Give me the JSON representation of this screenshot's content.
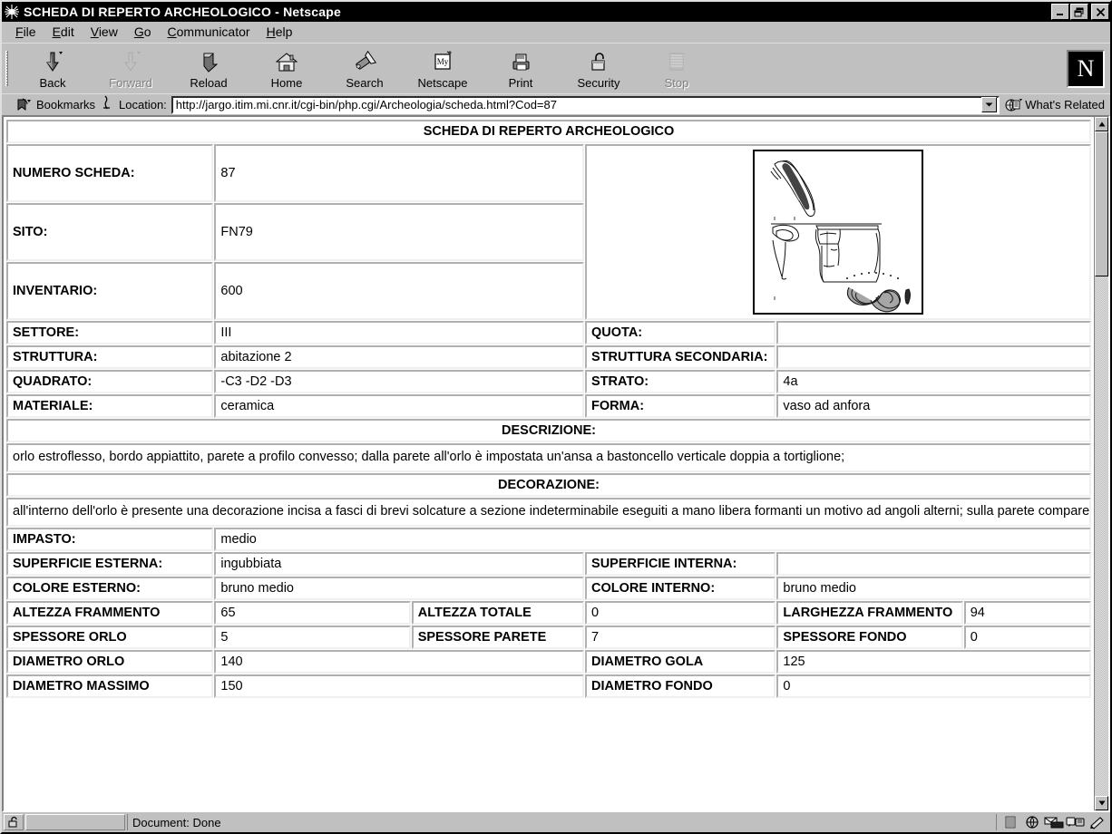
{
  "window": {
    "title": "SCHEDA DI REPERTO ARCHEOLOGICO - Netscape",
    "app_icon": "netscape-window-icon",
    "minimize_label": "_",
    "restore_label": "❐",
    "close_label": "✕"
  },
  "menu": [
    {
      "label": "File",
      "accel": "F"
    },
    {
      "label": "Edit",
      "accel": "E"
    },
    {
      "label": "View",
      "accel": "V"
    },
    {
      "label": "Go",
      "accel": "G"
    },
    {
      "label": "Communicator",
      "accel": "C"
    },
    {
      "label": "Help",
      "accel": "H"
    }
  ],
  "toolbar": {
    "buttons": [
      {
        "label": "Back",
        "icon": "back-arrow-icon",
        "enabled": true
      },
      {
        "label": "Forward",
        "icon": "forward-arrow-icon",
        "enabled": false
      },
      {
        "label": "Reload",
        "icon": "reload-icon",
        "enabled": true
      },
      {
        "label": "Home",
        "icon": "home-icon",
        "enabled": true
      },
      {
        "label": "Search",
        "icon": "search-flashlight-icon",
        "enabled": true
      },
      {
        "label": "Netscape",
        "icon": "my-netscape-icon",
        "enabled": true
      },
      {
        "label": "Print",
        "icon": "printer-icon",
        "enabled": true
      },
      {
        "label": "Security",
        "icon": "padlock-icon",
        "enabled": true
      },
      {
        "label": "Stop",
        "icon": "stop-icon",
        "enabled": false
      }
    ],
    "logo_letter": "N",
    "logo_name": "netscape-logo"
  },
  "location_bar": {
    "bookmarks_label": "Bookmarks",
    "bookmarks_icon": "bookmark-icon",
    "page_proxy_icon": "page-proxy-icon",
    "location_label": "Location:",
    "url": "http://jargo.itim.mi.cnr.it/cgi-bin/php.cgi/Archeologia/scheda.html?Cod=87",
    "url_placeholder": "Location:",
    "dropdown_icon": "chevron-down-icon",
    "whats_related_label": "What's Related",
    "whats_related_icon": "whats-related-icon"
  },
  "page": {
    "heading": "SCHEDA DI REPERTO ARCHEOLOGICO",
    "drawing_alt": "archaeological-pottery-drawing",
    "top_fields": [
      {
        "label": "NUMERO SCHEDA:",
        "value": "87"
      },
      {
        "label": "SITO:",
        "value": "FN79"
      },
      {
        "label": "INVENTARIO:",
        "value": "600"
      }
    ],
    "paired_fields": [
      {
        "left_label": "SETTORE:",
        "left_value": "III",
        "right_label": "QUOTA:",
        "right_value": ""
      },
      {
        "left_label": "STRUTTURA:",
        "left_value": "abitazione 2",
        "right_label": "STRUTTURA SECONDARIA:",
        "right_value": ""
      },
      {
        "left_label": "QUADRATO:",
        "left_value": "-C3 -D2 -D3",
        "right_label": "STRATO:",
        "right_value": "4a"
      },
      {
        "left_label": "MATERIALE:",
        "left_value": "ceramica",
        "right_label": "FORMA:",
        "right_value": "vaso ad anfora"
      }
    ],
    "descrizione": {
      "heading": "DESCRIZIONE:",
      "text": "orlo estroflesso, bordo appiattito, parete a profilo convesso; dalla parete all'orlo è impostata un'ansa a bastoncello verticale doppia a tortiglione;"
    },
    "decorazione": {
      "heading": "DECORAZIONE:",
      "text": "all'interno dell'orlo è presente una decorazione incisa a fasci di brevi solcature a sezione indeterminabile eseguiti a mano libera formanti un motivo ad angoli alterni; sulla parete compare una decorazione incisa e impressa con motivo a doppia protome di cigno formato da fasci di solcature a pettine e cuppelle, circondato da una linea curva di piccoli punti impressi."
    },
    "impasto": {
      "label": "IMPASTO:",
      "value": "medio"
    },
    "surface_fields": [
      {
        "left_label": "SUPERFICIE ESTERNA:",
        "left_value": "ingubbiata",
        "right_label": "SUPERFICIE INTERNA:",
        "right_value": ""
      },
      {
        "left_label": "COLORE ESTERNO:",
        "left_value": "bruno medio",
        "right_label": "COLORE INTERNO:",
        "right_value": "bruno medio"
      }
    ],
    "measure_rows": [
      {
        "l1": "ALTEZZA FRAMMENTO",
        "v1": "65",
        "l2": "ALTEZZA TOTALE",
        "v2": "0",
        "l3": "LARGHEZZA FRAMMENTO",
        "v3": "94"
      },
      {
        "l1": "SPESSORE ORLO",
        "v1": "5",
        "l2": "SPESSORE PARETE",
        "v2": "7",
        "l3": "SPESSORE FONDO",
        "v3": "0"
      }
    ],
    "diameter_rows": [
      {
        "left_label": "DIAMETRO ORLO",
        "left_value": "140",
        "right_label": "DIAMETRO GOLA",
        "right_value": "125"
      },
      {
        "left_label": "DIAMETRO MASSIMO",
        "left_value": "150",
        "right_label": "DIAMETRO FONDO",
        "right_value": "0"
      }
    ]
  },
  "status_bar": {
    "text": "Document: Done",
    "lock_icon": "unlocked-padlock-icon",
    "icons": [
      "online-status-icon",
      "web-icon",
      "mail-icon",
      "newsgroup-icon",
      "composer-icon"
    ]
  },
  "scrollbar": {
    "up_icon": "scroll-up-icon",
    "down_icon": "scroll-down-icon"
  },
  "colors": {
    "chrome": "#c0c0c0",
    "titlebar": "#000000",
    "page_bg": "#ffffff",
    "cell_border": "#c8c8c8"
  }
}
